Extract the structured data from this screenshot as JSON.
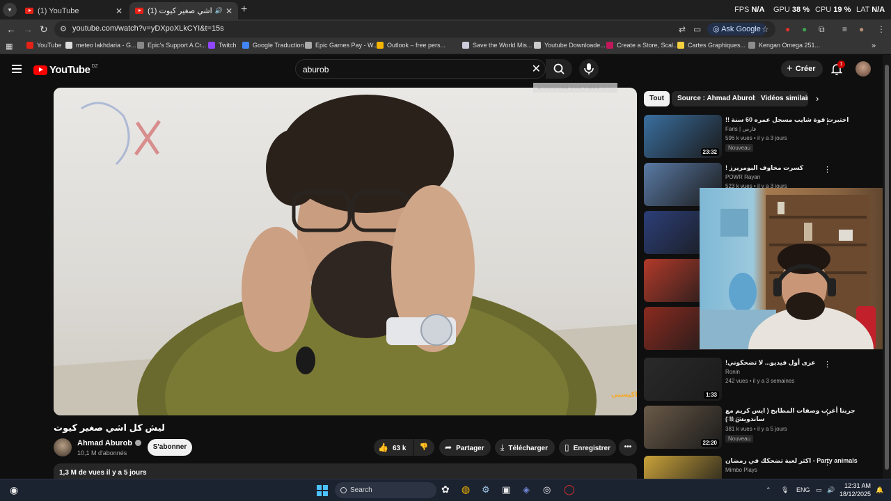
{
  "browser": {
    "tabs": [
      {
        "title": "(1) YouTube",
        "active": false
      },
      {
        "title": "(1) ليش كل اشي صغير كيوت",
        "active": true
      }
    ],
    "perf": {
      "fps_label": "FPS",
      "fps_value": "N/A",
      "gpu_label": "GPU",
      "gpu_value": "38 %",
      "cpu_label": "CPU",
      "cpu_value": "19 %",
      "lat_label": "LAT",
      "lat_value": "N/A"
    },
    "url": "youtube.com/watch?v=yDXpoXLkCYI&t=15s",
    "ask_google": "Ask Google",
    "bookmarks": [
      {
        "label": "YouTube",
        "color": "#e62117"
      },
      {
        "label": "meteo lakhdaria - G...",
        "color": "#dddddd"
      },
      {
        "label": "Epic's Support A Cr...",
        "color": "#888888"
      },
      {
        "label": "Twitch",
        "color": "#9146ff"
      },
      {
        "label": "Google Traduction",
        "color": "#4285f4"
      },
      {
        "label": "Epic Games Pay - W...",
        "color": "#aaaaaa"
      },
      {
        "label": "Outlook – free pers...",
        "color": "#f5b400"
      },
      {
        "label": "Save the World Mis...",
        "color": "#ccccdd"
      },
      {
        "label": "Youtube Downloade...",
        "color": "#cccccc"
      },
      {
        "label": "Create a Store, Scal...",
        "color": "#c2185b"
      },
      {
        "label": "Cartes Graphiques...",
        "color": "#f4d03f"
      },
      {
        "label": "Kengan Omega 251...",
        "color": "#8d8d8d"
      }
    ]
  },
  "youtube": {
    "logo": "YouTube",
    "country": "DZ",
    "search_query": "aburob",
    "create_label": "Créer",
    "notif_count": "1",
    "download_overlay": "Download this video",
    "video_watermark": "اكيسبي",
    "video": {
      "title": "ليش كل اشي صغير كيوت",
      "channel": "Ahmad Aburob",
      "subscribers": "10,1 M d'abonnés",
      "subscribe_label": "S'abonner",
      "likes": "63 k",
      "share_label": "Partager",
      "download_label": "Télécharger",
      "save_label": "Enregistrer",
      "description_meta": "1,3 M de vues  il y a 5 jours"
    },
    "chips": [
      {
        "label": "Tout",
        "selected": true
      },
      {
        "label": "Source : Ahmad Aburob",
        "selected": false
      },
      {
        "label": "Vidéos similaires",
        "selected": false
      }
    ],
    "recommendations": [
      {
        "title": "اختبرت قوة شايب مسجل عمره 60 سنة !!",
        "channel": "Faris | فارس",
        "views": "596 k vues",
        "age": "il y a 3 jours",
        "duration": "23:32",
        "badge": "Nouveau",
        "thumb_color": "#3a6fa0"
      },
      {
        "title": "كسرت مخاوف البومريرز !",
        "channel": "POWR Rayan",
        "views": "523 k vues",
        "age": "il y a 3 jours",
        "duration": "",
        "badge": "",
        "thumb_color": "#5a7aa5"
      },
      {
        "title": "",
        "channel": "",
        "views": "",
        "age": "",
        "duration": "",
        "badge": "",
        "thumb_color": "#2b3e78"
      },
      {
        "title": "",
        "channel": "",
        "views": "",
        "age": "",
        "duration": "",
        "badge": "",
        "thumb_color": "#b23a2a"
      },
      {
        "title": "",
        "channel": "",
        "views": "",
        "age": "",
        "duration": "",
        "badge": "",
        "thumb_color": "#8a2a1f"
      },
      {
        "title": "عرى أول فيديو... لا تضحكوني!",
        "channel": "Ronin",
        "views": "242 vues",
        "age": "il y a 3 semaines",
        "duration": "1:33",
        "badge": "",
        "thumb_color": "#2a2a2a"
      },
      {
        "title": "جربنا أغرب وصفات المطابخ ( ايس كريم مع ساندويش !! )",
        "channel": "F R S",
        "views": "381 k vues",
        "age": "il y a 5 jours",
        "duration": "22:20",
        "badge": "Nouveau",
        "thumb_color": "#6a5a48"
      },
      {
        "title": "Party animals - اكثر لعبة تضحكك في رمضان",
        "channel": "Mimbo Plays",
        "views": "",
        "age": "",
        "duration": "",
        "badge": "",
        "thumb_color": "#c9a23a"
      }
    ]
  },
  "taskbar": {
    "search_label": "Search",
    "language": "ENG",
    "time": "12:31 AM",
    "date": "18/12/2025"
  }
}
